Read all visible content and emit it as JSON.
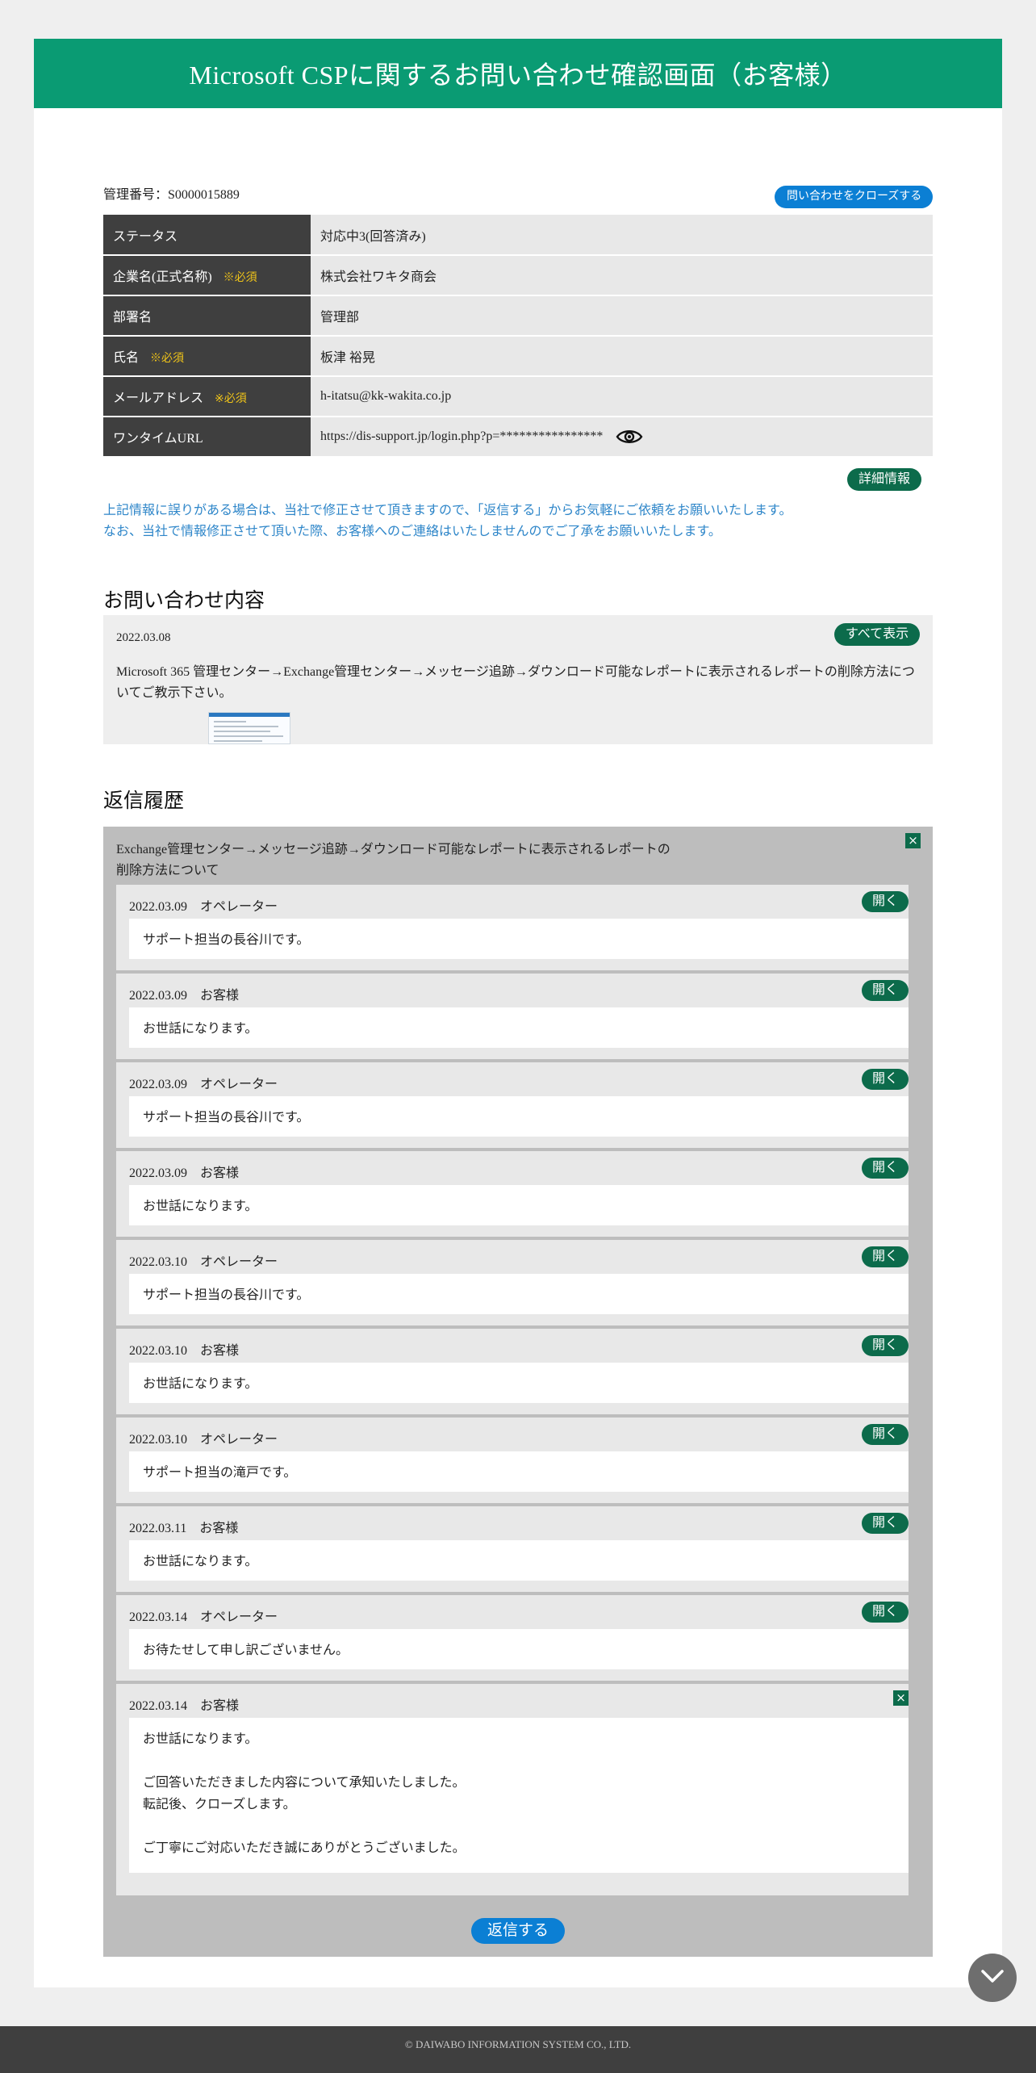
{
  "header": {
    "title": "Microsoft CSPに関するお問い合わせ確認画面（お客様）"
  },
  "management_no": "管理番号：S0000015889",
  "close_inquiry_label": "問い合わせをクローズする",
  "info_rows": [
    {
      "label": "ステータス",
      "required": "",
      "value": "対応中3(回答済み)"
    },
    {
      "label": "企業名(正式名称)",
      "required": "※必須",
      "value": "株式会社ワキタ商会"
    },
    {
      "label": "部署名",
      "required": "",
      "value": "管理部"
    },
    {
      "label": "氏名",
      "required": "※必須",
      "value": "板津 裕晃"
    },
    {
      "label": "メールアドレス",
      "required": "※必須",
      "value": "h-itatsu@kk-wakita.co.jp"
    },
    {
      "label": "ワンタイムURL",
      "required": "",
      "value": "https://dis-support.jp/login.php?p=****************"
    }
  ],
  "detail_label": "詳細情報",
  "notice": {
    "line1": "上記情報に誤りがある場合は、当社で修正させて頂きますので、「返信する」からお気軽にご依頼をお願いいたします。",
    "line2": "なお、当社で情報修正させて頂いた際、お客様へのご連絡はいたしませんのでご了承をお願いいたします。"
  },
  "inquiry": {
    "section_title": "お問い合わせ内容",
    "date": "2022.03.08",
    "show_all_label": "すべて表示",
    "text": "Microsoft 365 管理センター→Exchange管理センター→メッセージ追跡→ダウンロード可能なレポートに表示されるレポートの削除方法についてご教示下さい。"
  },
  "replies": {
    "section_title": "返信履歴",
    "subject": "Exchange管理センター→メッセージ追跡→ダウンロード可能なレポートに表示されるレポートの削除方法について",
    "open_label": "開く",
    "reply_label": "返信する",
    "entries": [
      {
        "meta": "2022.03.09　オペレーター",
        "body": "サポート担当の長谷川です。"
      },
      {
        "meta": "2022.03.09　お客様",
        "body": "お世話になります。"
      },
      {
        "meta": "2022.03.09　オペレーター",
        "body": "サポート担当の長谷川です。"
      },
      {
        "meta": "2022.03.09　お客様",
        "body": "お世話になります。"
      },
      {
        "meta": "2022.03.10　オペレーター",
        "body": "サポート担当の長谷川です。"
      },
      {
        "meta": "2022.03.10　お客様",
        "body": "お世話になります。"
      },
      {
        "meta": "2022.03.10　オペレーター",
        "body": "サポート担当の滝戸です。"
      },
      {
        "meta": "2022.03.11　お客様",
        "body": "お世話になります。"
      },
      {
        "meta": "2022.03.14　オペレーター",
        "body": "お待たせして申し訳ございません。"
      },
      {
        "meta": "2022.03.14　お客様",
        "body": "お世話になります。\n\nご回答いただきました内容について承知いたしました。\n転記後、クローズします。\n\nご丁寧にご対応いただき誠にありがとうございました。"
      }
    ]
  },
  "footer": "© DAIWABO INFORMATION SYSTEM CO., LTD."
}
